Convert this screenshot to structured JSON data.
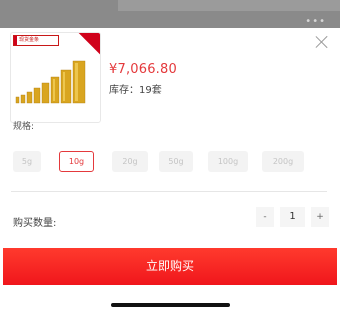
{
  "product": {
    "brand_label": "现货金条",
    "price": "¥7,066.80",
    "stock": "库存：19套"
  },
  "spec": {
    "label": "规格:",
    "options": [
      "5g",
      "10g",
      "20g",
      "50g",
      "100g",
      "200g"
    ],
    "selected": "10g"
  },
  "quantity": {
    "label": "购买数量:",
    "minus": "-",
    "value": "1",
    "plus": "+"
  },
  "buy_button": "立即购买",
  "colors": {
    "accent": "#e4393c",
    "button": "#f5201f"
  }
}
